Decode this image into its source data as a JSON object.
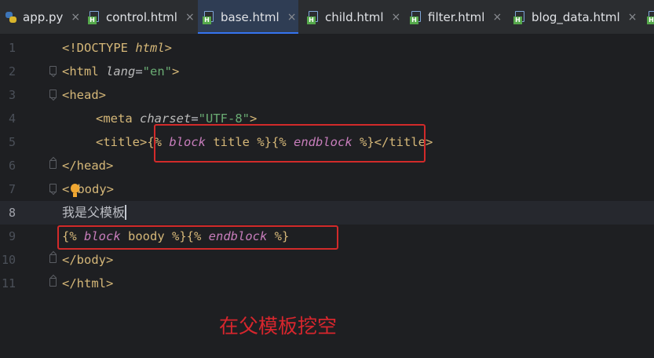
{
  "tabs": [
    {
      "label": "app.py",
      "icon": "python-file-icon",
      "active": false
    },
    {
      "label": "control.html",
      "icon": "html-file-icon",
      "active": false
    },
    {
      "label": "base.html",
      "icon": "html-file-icon",
      "active": true
    },
    {
      "label": "child.html",
      "icon": "html-file-icon",
      "active": false
    },
    {
      "label": "filter.html",
      "icon": "html-file-icon",
      "active": false
    },
    {
      "label": "blog_data.html",
      "icon": "html-file-icon",
      "active": false
    }
  ],
  "tab_close_glyph": "×",
  "html_badge": "H",
  "editor": {
    "current_line": 8,
    "lines": [
      {
        "number": "1",
        "tokens": [
          "<!DOCTYPE ",
          "html",
          ">"
        ]
      },
      {
        "number": "2",
        "tokens": [
          "<html ",
          "lang",
          "=",
          "\"en\"",
          ">"
        ]
      },
      {
        "number": "3",
        "tokens": [
          "<head>"
        ]
      },
      {
        "number": "4",
        "tokens": [
          "<meta ",
          "charset",
          "=",
          "\"UTF-8\"",
          ">"
        ]
      },
      {
        "number": "5",
        "tokens": [
          "<title>",
          "{% ",
          "block",
          " title ",
          "%}",
          "{% ",
          "endblock",
          " %}",
          "</title>"
        ]
      },
      {
        "number": "6",
        "tokens": [
          "</head>"
        ]
      },
      {
        "number": "7",
        "tokens": [
          "<",
          "body>"
        ]
      },
      {
        "number": "8",
        "tokens": [
          "我是父模板"
        ]
      },
      {
        "number": "9",
        "tokens": [
          "{% ",
          "block",
          " boody ",
          "%}",
          "{% ",
          "endblock",
          " %}"
        ]
      },
      {
        "number": "10",
        "tokens": [
          "</body>"
        ]
      },
      {
        "number": "11",
        "tokens": [
          "</html>"
        ]
      }
    ]
  },
  "annotation": "在父模板挖空",
  "colors": {
    "background": "#1e1f22",
    "tag": "#d5b778",
    "keyword": "#c77dbb",
    "string": "#6aab73",
    "annotation_red": "#d7262d",
    "highlight_box": "#d22a2a",
    "active_tab_underline": "#3574f0"
  }
}
